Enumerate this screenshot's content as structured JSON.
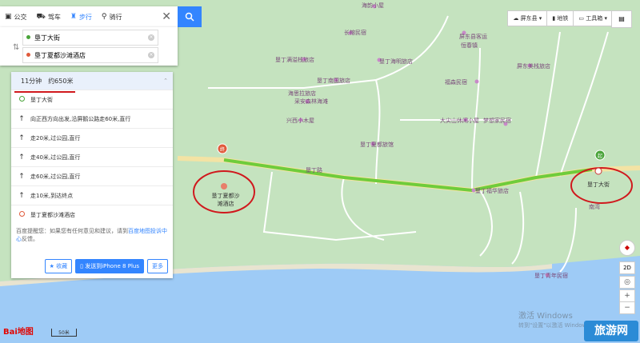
{
  "modes": [
    {
      "label": "公交",
      "icon": "bus-icon"
    },
    {
      "label": "驾车",
      "icon": "car-icon"
    },
    {
      "label": "步行",
      "icon": "walk-icon",
      "active": true
    },
    {
      "label": "骑行",
      "icon": "bike-icon"
    }
  ],
  "route": {
    "from": "垦丁大街",
    "to": "垦丁夏都沙滩酒店"
  },
  "summary": {
    "time": "11分钟",
    "distance": "约650米"
  },
  "steps": [
    {
      "text": "垦丁大街",
      "kind": "start"
    },
    {
      "text": "向正西方向出发,沿屏鹅公路走60米,直行",
      "kind": "arrow"
    },
    {
      "text": "走20米,过公园,直行",
      "kind": "arrow"
    },
    {
      "text": "走40米,过公园,直行",
      "kind": "arrow"
    },
    {
      "text": "走60米,过公园,直行",
      "kind": "arrow"
    },
    {
      "text": "走10米,到达终点",
      "kind": "arrow"
    },
    {
      "text": "垦丁夏都沙滩酒店",
      "kind": "end"
    }
  ],
  "feedback": {
    "prefix": "百度提醒您：如果您有任何意见和建议，请到",
    "link": "百度地图投诉中心",
    "suffix": "反馈。"
  },
  "actions": {
    "favorite": "收藏",
    "send": "发送到iPhone 8 Plus",
    "more": "更多"
  },
  "toolbar": {
    "region": "屏东县",
    "subway": "地铁",
    "tools": "工具箱"
  },
  "map_labels": [
    {
      "text": "海韵小屋"
    },
    {
      "text": "长榕民宿"
    },
    {
      "text": "垦丁满溢栈旅店"
    },
    {
      "text": "恒春镇"
    },
    {
      "text": "屏东县客运"
    },
    {
      "text": "屏东美栈旅店"
    },
    {
      "text": "垦丁南国旅店"
    },
    {
      "text": "福森民宿"
    },
    {
      "text": "垦丁海明旅店"
    },
    {
      "text": "海思拉旅店"
    },
    {
      "text": "采安森林海滩"
    },
    {
      "text": "兴西小木屋"
    },
    {
      "text": "大尖山休闲小屋"
    },
    {
      "text": "梦想家民宿"
    },
    {
      "text": "垦丁夏都旅馆"
    },
    {
      "text": "垦丁路"
    },
    {
      "text": "垦丁福华旅店"
    },
    {
      "text": "垦丁大街"
    },
    {
      "text": "垦丁夏都沙滩酒店"
    },
    {
      "text": "垦丁青年民宿"
    },
    {
      "text": "南湾"
    }
  ],
  "markers": {
    "start": "起",
    "end": "终"
  },
  "logo": "Bai地图",
  "scale": "50米",
  "watermark": {
    "line1": "激活 Windows",
    "line2": "转到\"设置\"以激活 Windows。"
  },
  "brand": "旅游网",
  "colors": {
    "route": "#6fcc3b",
    "accent": "#3385ff",
    "annotation": "#d0181d",
    "sea": "#9ecbf6",
    "land": "#c5e3bf"
  }
}
